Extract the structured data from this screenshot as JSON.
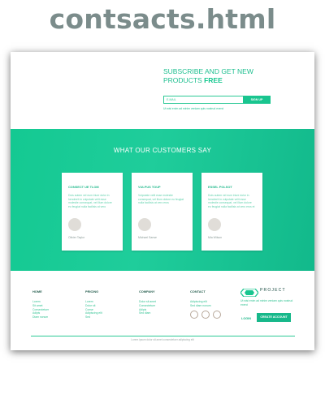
{
  "file_title": "contsacts.html",
  "subscribe": {
    "title_prefix": "SUBSCRIBE AND GET NEW PRODUCTS",
    "title_emphasis": "FREE",
    "email_placeholder": "E-MAIL",
    "button_label": "SIGN UP",
    "note": "Ut wisi enim ad minim veniam quis nostrud exerci"
  },
  "testimonials": {
    "title": "WHAT OUR CUSTOMERS SAY",
    "cards": [
      {
        "name": "CONSECT UE TLOM",
        "text": "Duis autem vel eum iriure dolor in hendrerit in vulputate velit esse molestie consequat, vel illum dolore eu feugiat nulla facilisis at vero",
        "author": "Olivier Taylor"
      },
      {
        "name": "VULPUS TOUP",
        "text": "Vulputate velit esse molestie consequat, vel illum dolore eu feugiat nulla facilisis at vero eros",
        "author": "Michael Sarwe"
      },
      {
        "name": "ESSEL POLSOT",
        "text": "Duis autem vel eum iriure dolor in hendrerit in vulputate velit esse molestie consequat, vel illum dolore eu feugiat nulla facilisis at vero eros et",
        "author": "Mia Wilson"
      }
    ]
  },
  "footer": {
    "columns": [
      {
        "heading": "HOME",
        "links": [
          "Lorem",
          "Sit amet",
          "Consectetuer",
          "Adipis",
          "Diam nonum"
        ]
      },
      {
        "heading": "PRICING",
        "links": [
          "Lorem",
          "Dolor sit",
          "Conse",
          "Adipiscing elit",
          "Sed"
        ]
      },
      {
        "heading": "COMPANY",
        "links": [
          "Dolor sit amet",
          "Consectetuer",
          "Adipis",
          "Sed diam"
        ]
      },
      {
        "heading": "CONTACT",
        "links": [
          "Adipiscing elit",
          "Sed diam nonum"
        ]
      }
    ],
    "logo_text": "PROJECT",
    "about_text": "Ut wisi enim ad minim veniam quis nostrud exerci",
    "login_label": "LOGIN",
    "create_label": "CREATE ACCOUNT",
    "copyright": "Lorem ipsum dolor sit amet consectetuer adipiscing elit"
  }
}
